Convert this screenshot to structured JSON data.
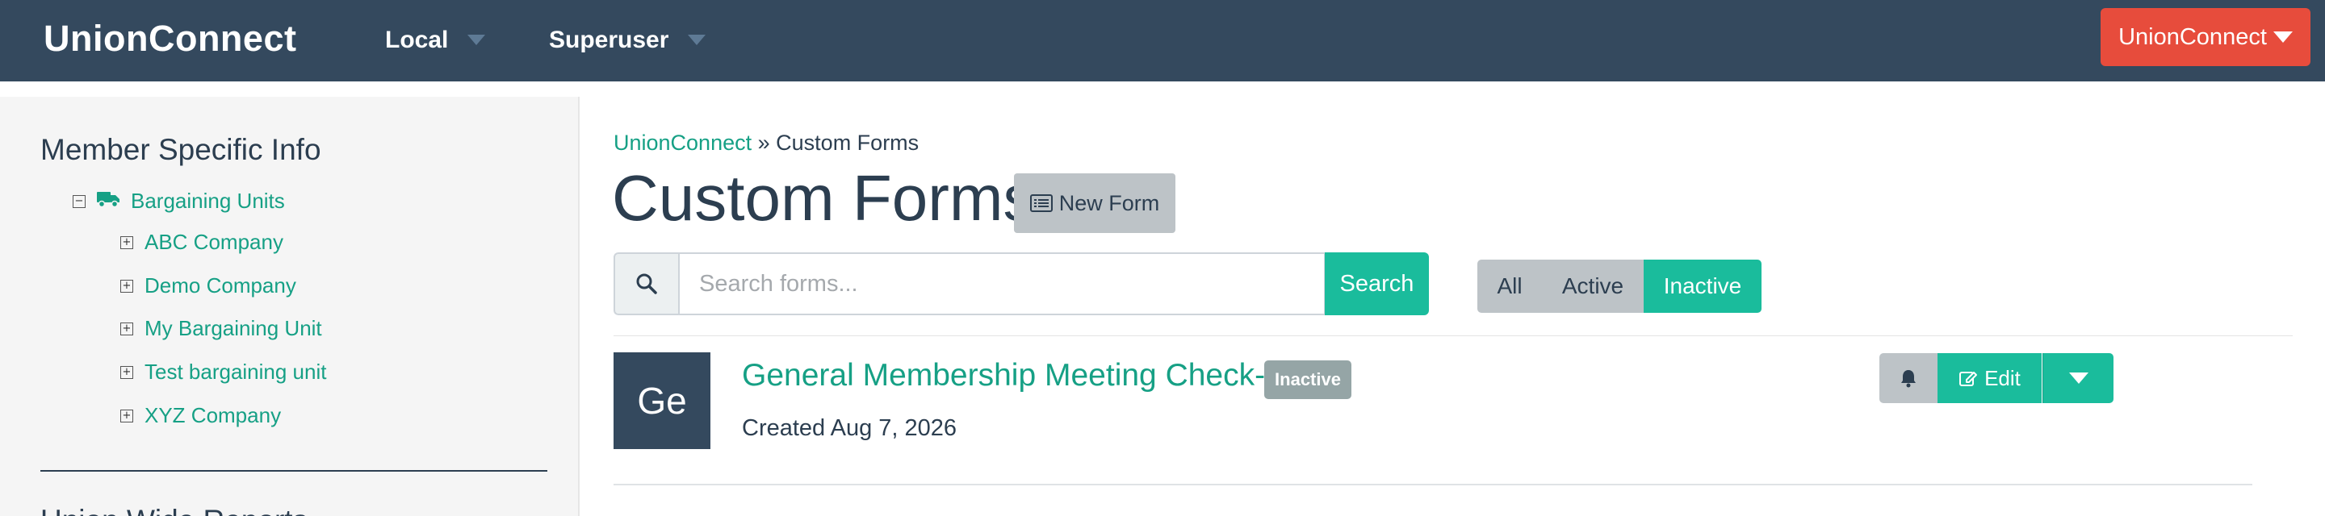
{
  "navbar": {
    "brand": "UnionConnect",
    "local_label": "Local",
    "superuser_label": "Superuser",
    "org_button_label": "UnionConnect"
  },
  "sidebar": {
    "title": "Member Specific Info",
    "tree_root": "Bargaining Units",
    "items": [
      {
        "label": "ABC Company"
      },
      {
        "label": "Demo Company"
      },
      {
        "label": "My Bargaining Unit"
      },
      {
        "label": "Test bargaining unit"
      },
      {
        "label": "XYZ Company"
      }
    ],
    "next_section_title": "Union Wide Reports"
  },
  "main": {
    "breadcrumb": {
      "home": "UnionConnect",
      "separator": " » ",
      "current": "Custom Forms"
    },
    "page_title": "Custom Forms",
    "new_form_label": "New Form",
    "search": {
      "placeholder": "Search forms...",
      "button_label": "Search"
    },
    "filters": {
      "all": "All",
      "active": "Active",
      "inactive": "Inactive",
      "selected": "Inactive"
    },
    "forms": [
      {
        "initials": "Ge",
        "title": "General Membership Meeting Check-In",
        "status": "Inactive",
        "created": "Created Aug 7, 2026",
        "edit_label": "Edit"
      }
    ]
  },
  "colors": {
    "navbar": "#34495e",
    "accent": "#1abc9c",
    "link": "#16a085",
    "danger": "#e74c3c",
    "muted": "#bdc3c7"
  }
}
